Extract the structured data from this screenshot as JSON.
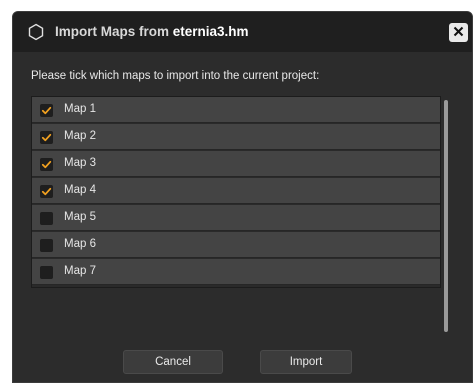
{
  "dialog": {
    "title_prefix": "Import Maps from ",
    "title_filename": "eternia3.hm",
    "close_label": "✕",
    "instructions": "Please tick which maps to import into the current project:",
    "maps": [
      {
        "label": "Map 1",
        "checked": true
      },
      {
        "label": "Map 2",
        "checked": true
      },
      {
        "label": "Map 3",
        "checked": true
      },
      {
        "label": "Map 4",
        "checked": true
      },
      {
        "label": "Map 5",
        "checked": false
      },
      {
        "label": "Map 6",
        "checked": false
      },
      {
        "label": "Map 7",
        "checked": false
      }
    ],
    "buttons": {
      "cancel": "Cancel",
      "import": "Import"
    }
  },
  "colors": {
    "check": "#f0a020",
    "dialog_bg": "#2c2c2c",
    "titlebar_bg": "#1f1f1f",
    "row_bg": "#444444"
  },
  "icons": {
    "app": "hexagon-icon",
    "close": "close-icon",
    "check": "checkmark-icon"
  }
}
